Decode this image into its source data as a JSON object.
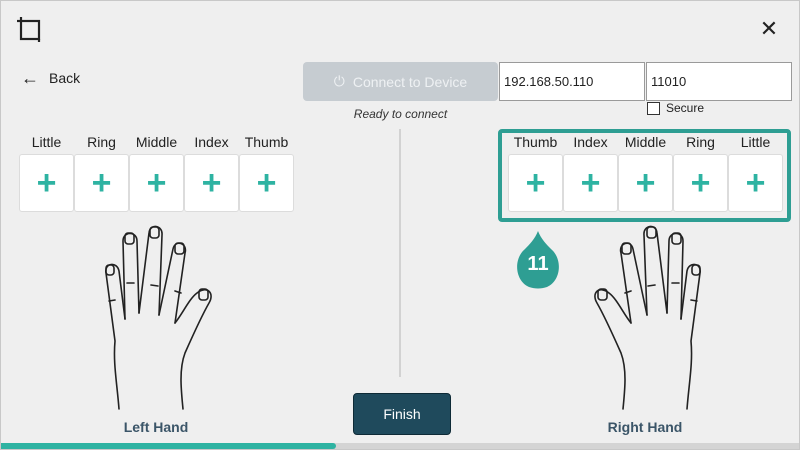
{
  "window": {
    "close_symbol": "✕"
  },
  "icons": {
    "app": "crop-square-icon",
    "back": "arrow-left-icon",
    "power": "power-icon",
    "close": "close-icon",
    "add": "plus-icon"
  },
  "nav": {
    "back_arrow": "←",
    "back_label": "Back"
  },
  "connection": {
    "connect_label": "Connect to Device",
    "power_symbol": "⏻",
    "status": "Ready to connect",
    "ip_value": "192.168.50.110",
    "port_value": "11010",
    "secure_label": "Secure",
    "secure_checked": false
  },
  "left_hand": {
    "fingers": [
      "Little",
      "Ring",
      "Middle",
      "Index",
      "Thumb"
    ],
    "caption": "Left Hand"
  },
  "right_hand": {
    "fingers": [
      "Thumb",
      "Index",
      "Middle",
      "Ring",
      "Little"
    ],
    "caption": "Right Hand"
  },
  "add_symbol": "+",
  "callout_number": "11",
  "finish_label": "Finish",
  "progress": {
    "fraction": 0.42
  },
  "colors": {
    "accent": "#2eb3a2",
    "highlight": "#2e9e93",
    "finish_bg": "#1f4a5c",
    "caption": "#3b5568",
    "disabled_btn": "#c6ccd1"
  }
}
